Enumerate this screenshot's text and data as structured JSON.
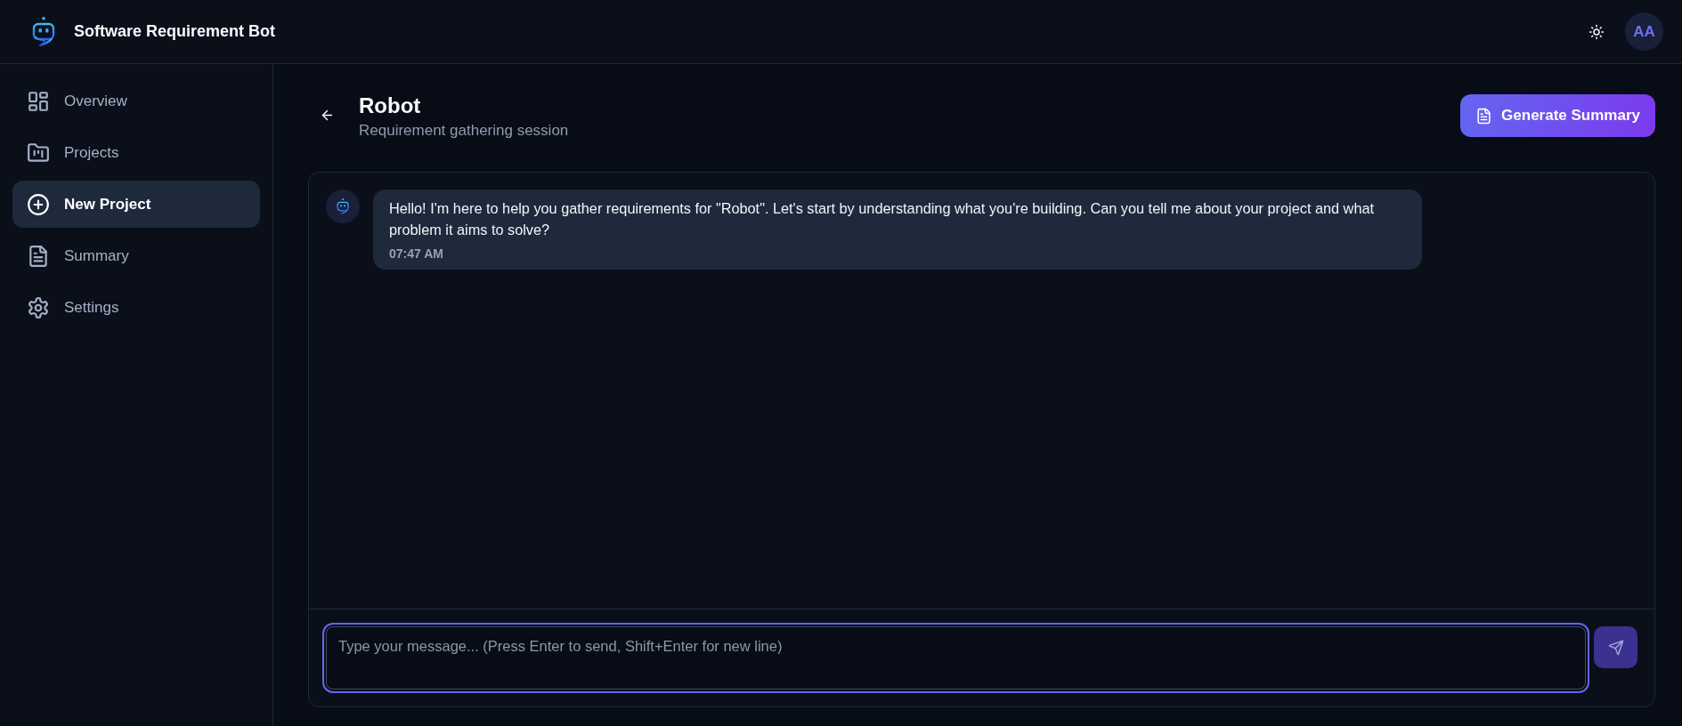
{
  "app": {
    "title": "Software Requirement Bot"
  },
  "header": {
    "user_initials": "AA"
  },
  "sidebar": {
    "items": [
      {
        "label": "Overview",
        "selected": false
      },
      {
        "label": "Projects",
        "selected": false
      },
      {
        "label": "New Project",
        "selected": true
      },
      {
        "label": "Summary",
        "selected": false
      },
      {
        "label": "Settings",
        "selected": false
      }
    ]
  },
  "page": {
    "title": "Robot",
    "subtitle": "Requirement gathering session",
    "action": "Generate Summary"
  },
  "chat": {
    "messages": [
      {
        "kind": "bot",
        "text": "Hello! I'm here to help you gather requirements for \"Robot\". Let's start by understanding what you're building. Can you tell me about your project and what problem it aims to solve?",
        "time": "07:47 AM"
      }
    ],
    "input": {
      "placeholder": "Type your message... (Press Enter to send, Shift+Enter for new line)",
      "focused": true
    },
    "send_button": {
      "disabled": true
    }
  }
}
